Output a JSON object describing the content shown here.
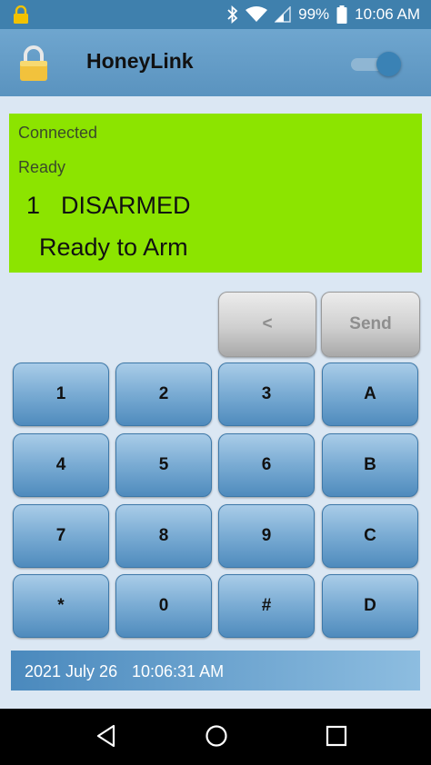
{
  "status_bar": {
    "battery_percent": "99%",
    "time": "10:06 AM",
    "icons": [
      "lock-icon",
      "bluetooth-icon",
      "wifi-icon",
      "cell-signal-icon",
      "battery-icon"
    ]
  },
  "app_bar": {
    "title": "HoneyLink",
    "toggle_on": true,
    "icons": [
      "padlock-icon"
    ]
  },
  "panel": {
    "connected": "Connected",
    "ready": "Ready",
    "zone": "1",
    "state": "DISARMED",
    "message": "Ready to Arm",
    "color": "#8ce400"
  },
  "actions": {
    "backspace_label": "<",
    "send_label": "Send"
  },
  "keypad": {
    "keys": [
      "1",
      "2",
      "3",
      "A",
      "4",
      "5",
      "6",
      "B",
      "7",
      "8",
      "9",
      "C",
      "*",
      "0",
      "#",
      "D"
    ]
  },
  "footer": {
    "date": "2021 July 26",
    "time": "10:06:31 AM"
  },
  "nav": {
    "icons": [
      "back-icon",
      "home-icon",
      "recents-icon"
    ]
  },
  "colors": {
    "accent": "#3f80ad",
    "key_blue": "#79abd3"
  }
}
